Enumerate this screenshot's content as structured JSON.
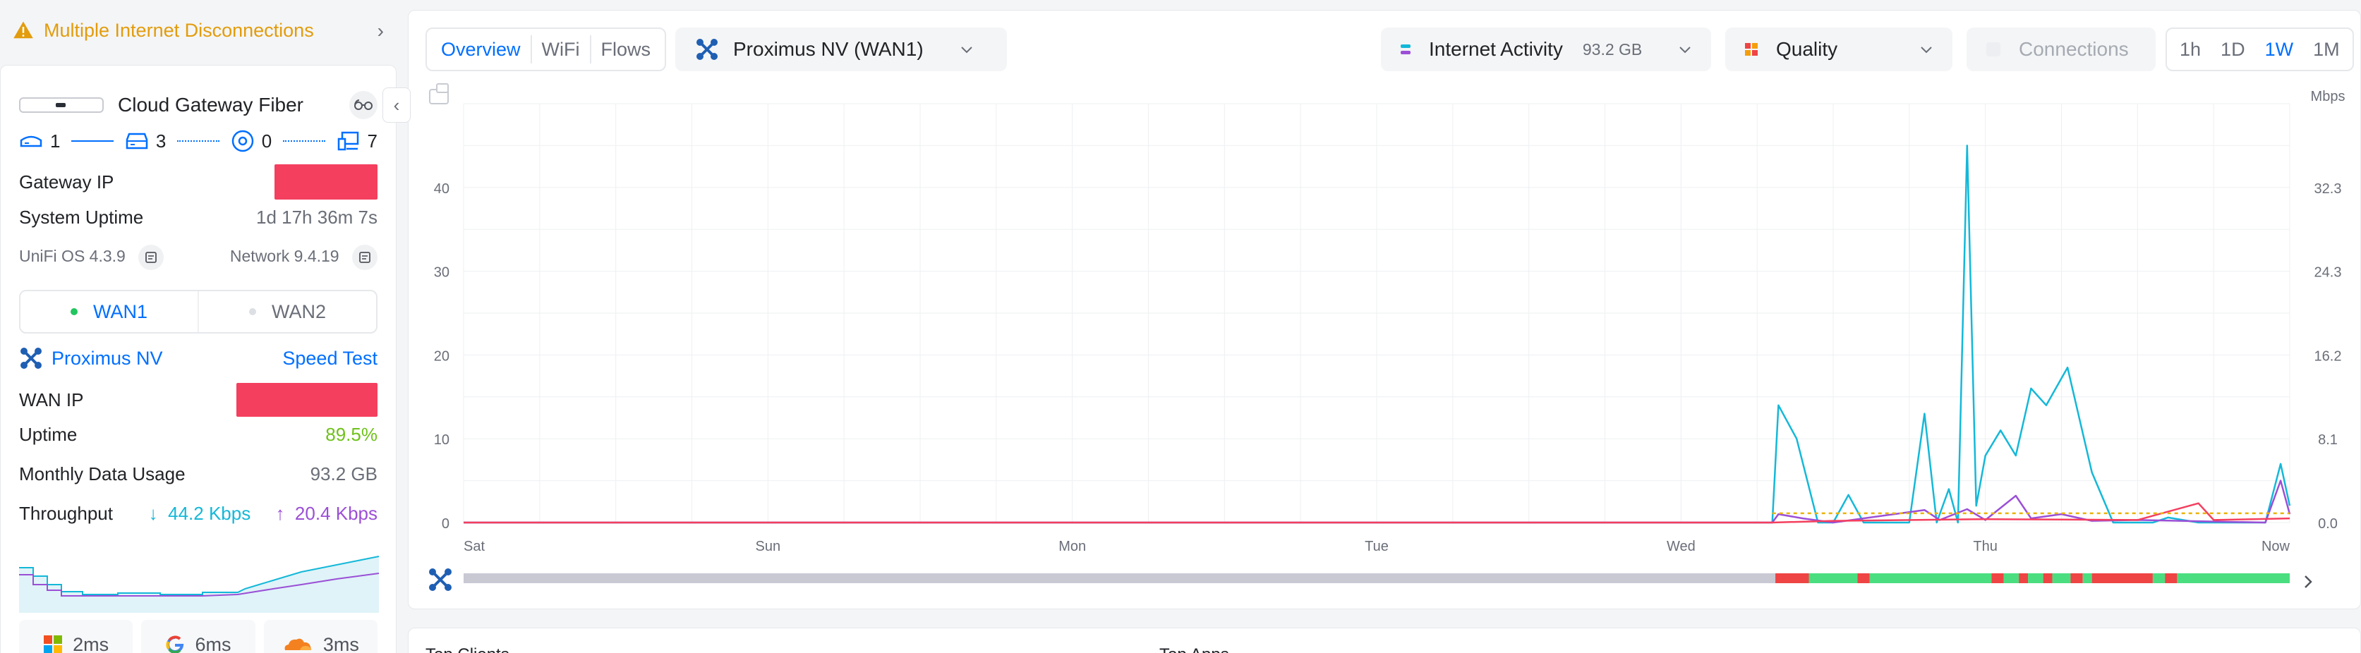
{
  "warning": {
    "text": "Multiple Internet Disconnections"
  },
  "gateway": {
    "name": "Cloud Gateway Fiber",
    "topology": {
      "gateways": "1",
      "switches": "3",
      "access_points": "0",
      "clients": "7"
    },
    "gateway_ip_label": "Gateway IP",
    "system_uptime_label": "System Uptime",
    "system_uptime_value": "1d 17h 36m 7s",
    "os_version": "UniFi OS 4.3.9",
    "network_version": "Network 9.4.19"
  },
  "wan_tabs": [
    {
      "label": "WAN1"
    },
    {
      "label": "WAN2"
    }
  ],
  "wan": {
    "isp_name": "Proximus NV",
    "speed_test_label": "Speed Test",
    "wan_ip_label": "WAN IP",
    "uptime_label": "Uptime",
    "uptime_value": "89.5%",
    "usage_label": "Monthly Data Usage",
    "usage_value": "93.2 GB",
    "throughput_label": "Throughput",
    "download": "44.2 Kbps",
    "upload": "20.4 Kbps"
  },
  "latency": [
    {
      "icon": "microsoft-icon",
      "value": "2ms"
    },
    {
      "icon": "google-icon",
      "value": "6ms"
    },
    {
      "icon": "cloudflare-icon",
      "value": "3ms"
    }
  ],
  "view_tabs": [
    {
      "label": "Overview"
    },
    {
      "label": "WiFi"
    },
    {
      "label": "Flows"
    }
  ],
  "wan_select": {
    "label": "Proximus NV (WAN1)"
  },
  "activity_select": {
    "label": "Internet Activity",
    "badge": "93.2 GB"
  },
  "quality_select": {
    "label": "Quality"
  },
  "connections_select": {
    "label": "Connections"
  },
  "range_tabs": [
    {
      "label": "1h"
    },
    {
      "label": "1D"
    },
    {
      "label": "1W",
      "active": true
    },
    {
      "label": "1M"
    }
  ],
  "bottom": {
    "left_title": "Top Clients",
    "right_title": "Top Apps"
  },
  "colors": {
    "accent": "#006fff",
    "download": "#14b8d8",
    "upload": "#9b4fd6",
    "good": "#4ade80",
    "bad": "#ef4444",
    "warning": "#e29c0d"
  },
  "chart_data": {
    "type": "line",
    "x_categories": [
      "Sat",
      "Sun",
      "Mon",
      "Tue",
      "Wed",
      "Thu",
      "Now"
    ],
    "y_left": {
      "ticks": [
        "0",
        "10",
        "20",
        "30",
        "40"
      ],
      "range": [
        0,
        50
      ]
    },
    "y_right": {
      "label": "Mbps",
      "ticks": [
        "0.0",
        "8.1",
        "16.2",
        "24.3",
        "32.3"
      ]
    },
    "grid": true,
    "series": [
      {
        "color": "#14b8d8",
        "points": [
          [
            0,
            0
          ],
          [
            4.3,
            0
          ],
          [
            4.32,
            14
          ],
          [
            4.38,
            10
          ],
          [
            4.45,
            0
          ],
          [
            4.5,
            0
          ],
          [
            4.55,
            3.3
          ],
          [
            4.6,
            0
          ],
          [
            4.75,
            0
          ],
          [
            4.8,
            13
          ],
          [
            4.84,
            0
          ],
          [
            4.88,
            4
          ],
          [
            4.91,
            0
          ],
          [
            4.94,
            45
          ],
          [
            4.97,
            2
          ],
          [
            5.0,
            8
          ],
          [
            5.05,
            11
          ],
          [
            5.1,
            8
          ],
          [
            5.15,
            16
          ],
          [
            5.2,
            14
          ],
          [
            5.27,
            18.5
          ],
          [
            5.35,
            6
          ],
          [
            5.42,
            0
          ],
          [
            5.55,
            0
          ],
          [
            5.6,
            0.6
          ],
          [
            5.7,
            0
          ],
          [
            5.92,
            0
          ],
          [
            5.97,
            7
          ],
          [
            6,
            2
          ]
        ]
      },
      {
        "color": "#9b4fd6",
        "points": [
          [
            0,
            0
          ],
          [
            4.3,
            0
          ],
          [
            4.32,
            1
          ],
          [
            4.4,
            0.5
          ],
          [
            4.5,
            0
          ],
          [
            4.8,
            1.5
          ],
          [
            4.85,
            0.3
          ],
          [
            4.94,
            1.6
          ],
          [
            5.0,
            0.3
          ],
          [
            5.1,
            3.2
          ],
          [
            5.15,
            0.5
          ],
          [
            5.25,
            1
          ],
          [
            5.35,
            0.2
          ],
          [
            5.5,
            0.3
          ],
          [
            5.92,
            0
          ],
          [
            5.97,
            5
          ],
          [
            6,
            1
          ]
        ]
      },
      {
        "color": "#f43f5e",
        "points": [
          [
            0,
            0
          ],
          [
            4.3,
            0
          ],
          [
            4.5,
            0.2
          ],
          [
            5.0,
            0.4
          ],
          [
            5.5,
            0.3
          ],
          [
            5.7,
            2.3
          ],
          [
            5.75,
            0.3
          ],
          [
            6,
            0.5
          ]
        ]
      },
      {
        "color": "#eab308",
        "dashed": true,
        "points": [
          [
            4.3,
            1.1
          ],
          [
            6,
            1.1
          ]
        ]
      }
    ],
    "quality_bar": {
      "segments": [
        {
          "from": 0,
          "to": 4.31,
          "status": "unknown"
        },
        {
          "from": 4.31,
          "to": 4.42,
          "status": "bad"
        },
        {
          "from": 4.42,
          "to": 4.58,
          "status": "good"
        },
        {
          "from": 4.58,
          "to": 4.62,
          "status": "bad"
        },
        {
          "from": 4.62,
          "to": 5.02,
          "status": "good"
        },
        {
          "from": 5.02,
          "to": 5.06,
          "status": "bad"
        },
        {
          "from": 5.06,
          "to": 5.11,
          "status": "good"
        },
        {
          "from": 5.11,
          "to": 5.14,
          "status": "bad"
        },
        {
          "from": 5.14,
          "to": 5.19,
          "status": "good"
        },
        {
          "from": 5.19,
          "to": 5.22,
          "status": "bad"
        },
        {
          "from": 5.22,
          "to": 5.28,
          "status": "good"
        },
        {
          "from": 5.28,
          "to": 5.32,
          "status": "bad"
        },
        {
          "from": 5.32,
          "to": 5.35,
          "status": "good"
        },
        {
          "from": 5.35,
          "to": 5.55,
          "status": "bad"
        },
        {
          "from": 5.55,
          "to": 5.59,
          "status": "good"
        },
        {
          "from": 5.59,
          "to": 5.63,
          "status": "bad"
        },
        {
          "from": 5.63,
          "to": 6,
          "status": "good"
        }
      ]
    }
  }
}
